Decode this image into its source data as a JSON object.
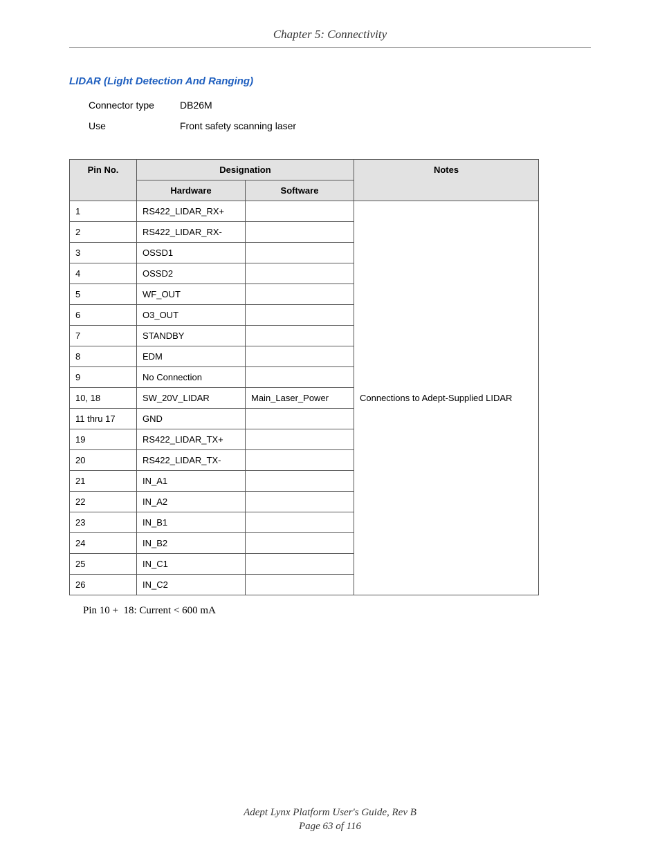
{
  "header": {
    "chapter": "Chapter 5: Connectivity"
  },
  "section": {
    "title": "LIDAR (Light Detection And Ranging)",
    "info": [
      {
        "label": "Connector type",
        "value": "DB26M"
      },
      {
        "label": "Use",
        "value": "Front safety scanning laser"
      }
    ]
  },
  "table": {
    "headers": {
      "designation": "Designation",
      "pin_no": "Pin No.",
      "hardware": "Hardware",
      "software": "Software",
      "notes": "Notes"
    },
    "rows": [
      {
        "pin": "1",
        "hardware": "RS422_LIDAR_RX+",
        "software": ""
      },
      {
        "pin": "2",
        "hardware": "RS422_LIDAR_RX-",
        "software": ""
      },
      {
        "pin": "3",
        "hardware": "OSSD1",
        "software": ""
      },
      {
        "pin": "4",
        "hardware": "OSSD2",
        "software": ""
      },
      {
        "pin": "5",
        "hardware": "WF_OUT",
        "software": ""
      },
      {
        "pin": "6",
        "hardware": "O3_OUT",
        "software": ""
      },
      {
        "pin": "7",
        "hardware": "STANDBY",
        "software": ""
      },
      {
        "pin": "8",
        "hardware": "EDM",
        "software": ""
      },
      {
        "pin": "9",
        "hardware": "No Connection",
        "software": ""
      },
      {
        "pin": "10, 18",
        "hardware": "SW_20V_LIDAR",
        "software": "Main_Laser_Power"
      },
      {
        "pin": "11 thru 17",
        "hardware": "GND",
        "software": ""
      },
      {
        "pin": "19",
        "hardware": "RS422_LIDAR_TX+",
        "software": ""
      },
      {
        "pin": "20",
        "hardware": "RS422_LIDAR_TX-",
        "software": ""
      },
      {
        "pin": "21",
        "hardware": "IN_A1",
        "software": ""
      },
      {
        "pin": "22",
        "hardware": "IN_A2",
        "software": ""
      },
      {
        "pin": "23",
        "hardware": "IN_B1",
        "software": ""
      },
      {
        "pin": "24",
        "hardware": "IN_B2",
        "software": ""
      },
      {
        "pin": "25",
        "hardware": "IN_C1",
        "software": ""
      },
      {
        "pin": "26",
        "hardware": "IN_C2",
        "software": ""
      }
    ],
    "notes_merged": "Connections to Adept-Supplied LIDAR"
  },
  "footnote": "Pin 10 +  18: Current < 600 mA",
  "footer": {
    "title": "Adept Lynx Platform User's Guide, Rev B",
    "page": "Page 63 of 116"
  }
}
